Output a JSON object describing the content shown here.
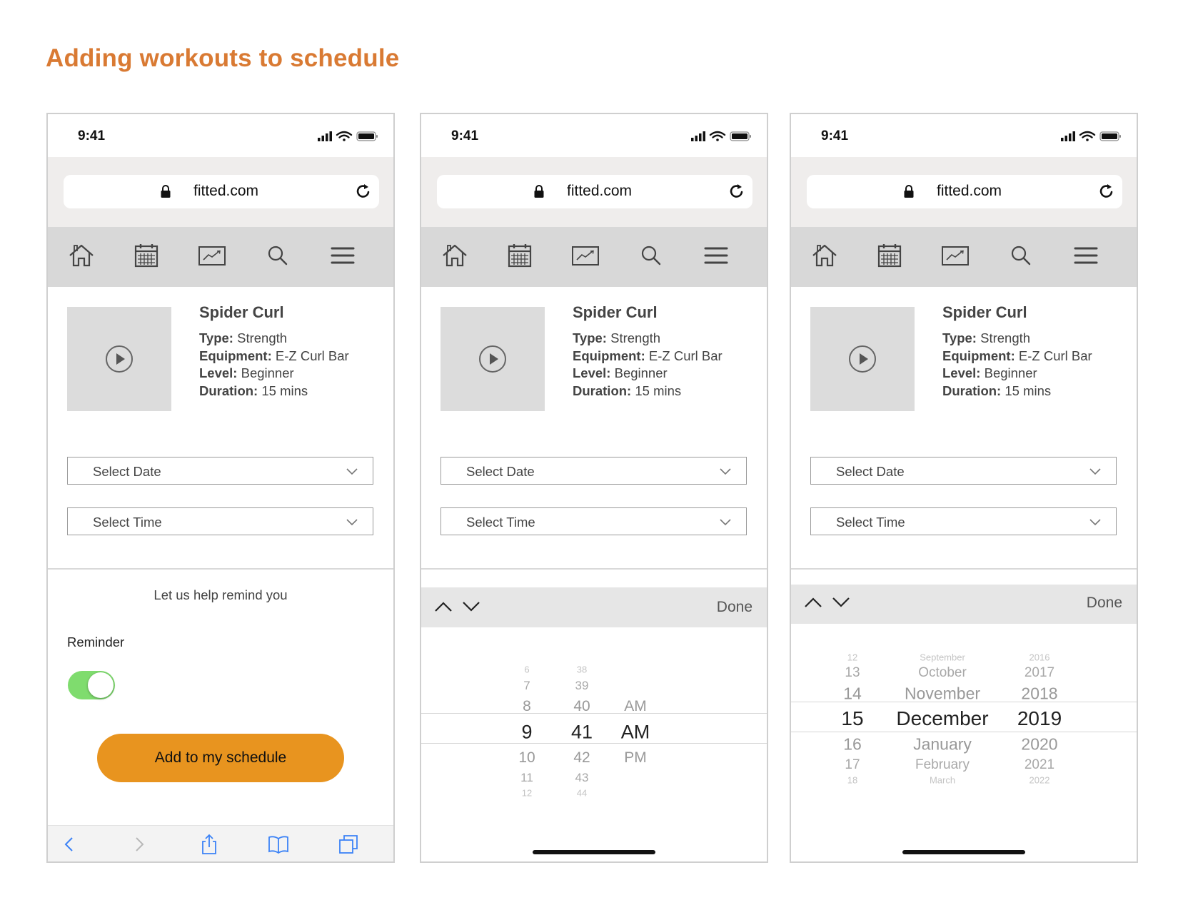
{
  "page_title": "Adding workouts to schedule",
  "status_bar": {
    "time": "9:41",
    "icons": [
      "signal-icon",
      "wifi-icon",
      "battery-icon"
    ]
  },
  "browser": {
    "url": "fitted.com",
    "icons": [
      "lock-icon",
      "reload-icon"
    ]
  },
  "nav_icons": [
    "home-icon",
    "calendar-icon",
    "progress-chart-icon",
    "search-icon",
    "menu-icon"
  ],
  "workout": {
    "name": "Spider Curl",
    "type_label": "Type:",
    "type_value": " Strength",
    "equipment_label": "Equipment:",
    "equipment_value": " E-Z Curl Bar",
    "level_label": "Level:",
    "level_value": " Beginner",
    "duration_label": "Duration:",
    "duration_value": " 15 mins"
  },
  "form": {
    "date_placeholder": "Select Date",
    "time_placeholder": "Select Time"
  },
  "reminder": {
    "helper_text": "Let us help remind you",
    "label": "Reminder",
    "enabled": true,
    "cta_label": "Add to my schedule"
  },
  "safari_toolbar": [
    "back-icon",
    "forward-icon",
    "share-icon",
    "bookmarks-icon",
    "tabs-icon"
  ],
  "picker_toolbar": {
    "done_label": "Done"
  },
  "time_picker": {
    "hour_items": [
      "6",
      "7",
      "8",
      "9",
      "10",
      "11",
      "12"
    ],
    "minute_items": [
      "38",
      "39",
      "40",
      "41",
      "42",
      "43",
      "44"
    ],
    "period_items": [
      "AM",
      "AM",
      "PM"
    ],
    "selected": {
      "hour": "9",
      "minute": "41",
      "period": "AM"
    }
  },
  "date_picker": {
    "day_items": [
      "12",
      "13",
      "14",
      "15",
      "16",
      "17",
      "18"
    ],
    "month_items": [
      "September",
      "October",
      "November",
      "December",
      "January",
      "February",
      "March"
    ],
    "year_items": [
      "2016",
      "2017",
      "2018",
      "2019",
      "2020",
      "2021",
      "2022"
    ],
    "selected": {
      "day": "15",
      "month": "December",
      "year": "2019"
    }
  },
  "colors": {
    "title": "#d97a33",
    "cta": "#e8941f",
    "toggle_on": "#7fdc6e",
    "nav_bg": "#d8d8d8",
    "url_area_bg": "#efedec"
  }
}
